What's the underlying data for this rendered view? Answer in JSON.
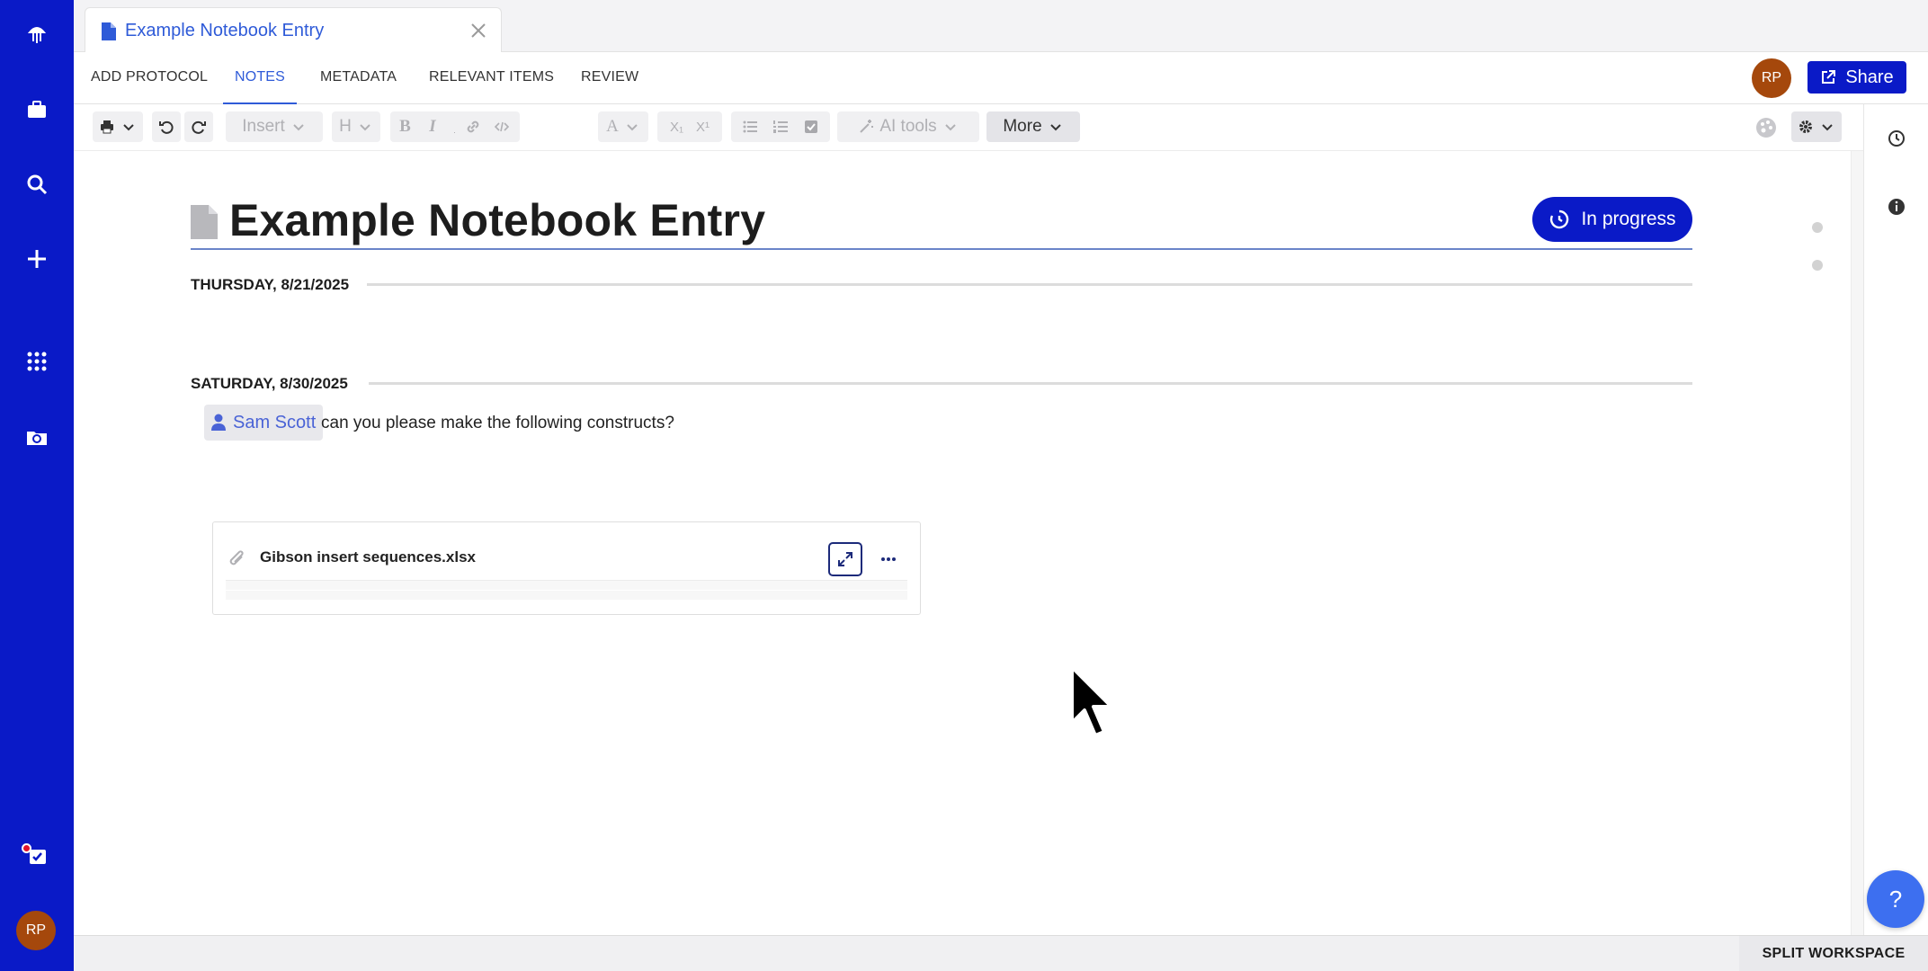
{
  "window": {
    "tab_title": "Example Notebook Entry"
  },
  "nav": {
    "tabs": [
      {
        "label": "ADD PROTOCOL",
        "active": false
      },
      {
        "label": "NOTES",
        "active": true
      },
      {
        "label": "METADATA",
        "active": false
      },
      {
        "label": "RELEVANT ITEMS",
        "active": false
      },
      {
        "label": "REVIEW",
        "active": false
      }
    ],
    "user_initials": "RP",
    "share_label": "Share"
  },
  "toolbar": {
    "insert_label": "Insert",
    "heading_label": "H",
    "text_color_label": "A",
    "ai_tools_label": "AI tools",
    "more_label": "More"
  },
  "entry": {
    "title": "Example Notebook Entry",
    "status_label": "In progress",
    "sections": [
      {
        "date": "THURSDAY, 8/21/2025"
      },
      {
        "date": "SATURDAY, 8/30/2025"
      }
    ],
    "mention_name": "Sam Scott",
    "note_text": "can you please make the following constructs?",
    "attachment_name": "Gibson insert sequences.xlsx"
  },
  "rail": {
    "user_initials": "RP"
  },
  "footer": {
    "split_label": "SPLIT WORKSPACE"
  },
  "help_label": "?",
  "colors": {
    "brand": "#0a1ac7",
    "accent": "#2f5bd8",
    "avatar": "#a5480c"
  }
}
